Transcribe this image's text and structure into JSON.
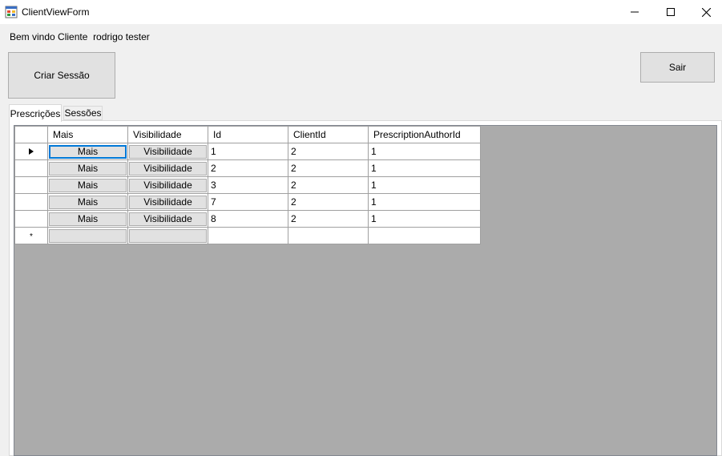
{
  "window": {
    "title": "ClientViewForm",
    "controls": {
      "minimize": "minimize-icon",
      "maximize": "maximize-icon",
      "close": "close-icon"
    }
  },
  "welcome": {
    "prefix": "Bem vindo Cliente  ",
    "user": "rodrigo tester"
  },
  "buttons": {
    "create_session": "Criar Sessão",
    "exit": "Sair"
  },
  "tabs": [
    {
      "label": "Prescrições",
      "active": true
    },
    {
      "label": "Sessões",
      "active": false
    }
  ],
  "grid": {
    "columns": [
      "Mais",
      "Visibilidade",
      "Id",
      "ClientId",
      "PrescriptionAuthorId"
    ],
    "rows": [
      {
        "mais": "Mais",
        "visibilidade": "Visibilidade",
        "id": "1",
        "client_id": "2",
        "author_id": "1"
      },
      {
        "mais": "Mais",
        "visibilidade": "Visibilidade",
        "id": "2",
        "client_id": "2",
        "author_id": "1"
      },
      {
        "mais": "Mais",
        "visibilidade": "Visibilidade",
        "id": "3",
        "client_id": "2",
        "author_id": "1"
      },
      {
        "mais": "Mais",
        "visibilidade": "Visibilidade",
        "id": "7",
        "client_id": "2",
        "author_id": "1"
      },
      {
        "mais": "Mais",
        "visibilidade": "Visibilidade",
        "id": "8",
        "client_id": "2",
        "author_id": "1"
      }
    ],
    "current_row_marker": "▶",
    "new_row_marker": "*"
  },
  "colors": {
    "grid_background": "#ababab",
    "focus": "#0078d7"
  }
}
